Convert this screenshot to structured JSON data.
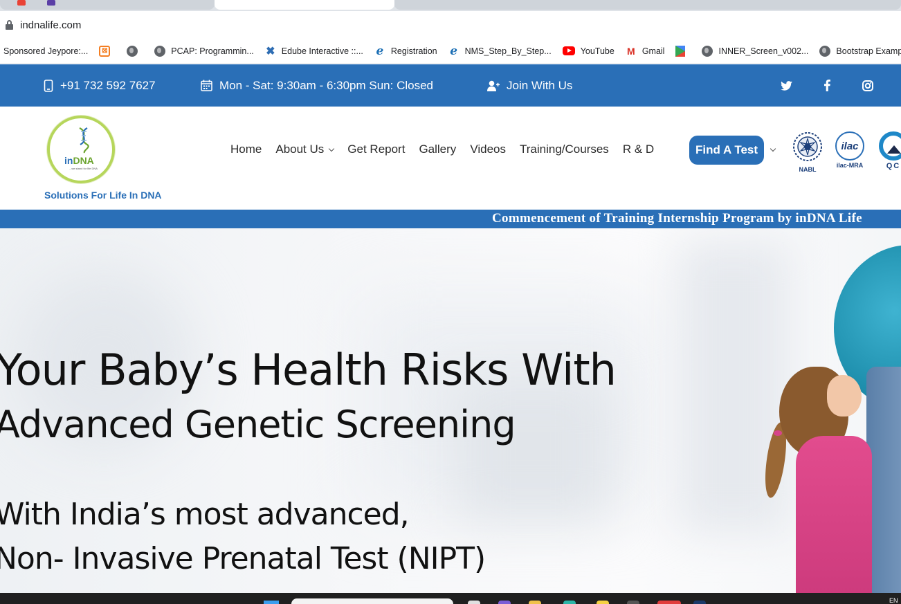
{
  "browser": {
    "url": "indnalife.com",
    "bookmarks": [
      {
        "label": "Sponsored Jeypore:...",
        "icon": "none"
      },
      {
        "label": "",
        "icon": "xampp-icon"
      },
      {
        "label": "",
        "icon": "globe-icon"
      },
      {
        "label": "PCAP: Programmin...",
        "icon": "globe-icon"
      },
      {
        "label": "Edube Interactive ::...",
        "icon": "edube-icon"
      },
      {
        "label": "Registration",
        "icon": "ie-icon"
      },
      {
        "label": "NMS_Step_By_Step...",
        "icon": "ie-icon"
      },
      {
        "label": "YouTube",
        "icon": "youtube-icon"
      },
      {
        "label": "Gmail",
        "icon": "gmail-icon"
      },
      {
        "label": "",
        "icon": "play-store-icon"
      },
      {
        "label": "INNER_Screen_v002...",
        "icon": "globe-icon"
      },
      {
        "label": "Bootstrap Exampl",
        "icon": "globe-icon"
      }
    ]
  },
  "topbar": {
    "phone": "+91 732 592 7627",
    "hours": "Mon - Sat: 9:30am - 6:30pm Sun: Closed",
    "join": "Join With Us",
    "social": [
      "twitter-icon",
      "facebook-icon",
      "instagram-icon"
    ]
  },
  "logo": {
    "brand_in": "in",
    "brand_dna": "DNA",
    "small": "...we stand for life DNA",
    "tagline": "Solutions For Life In DNA"
  },
  "nav": {
    "items": [
      "Home",
      "About Us",
      "Get Report",
      "Gallery",
      "Videos",
      "Training/Courses",
      "R & D"
    ],
    "cta": "Find A Test"
  },
  "accreditations": [
    {
      "label": "NABL",
      "text": ""
    },
    {
      "label": "ilac-MRA",
      "text": "ilac"
    },
    {
      "label": "",
      "text": "QC"
    }
  ],
  "marquee": "Commencement of Training Internship Program by inDNA Life",
  "hero": {
    "line1": "Your Baby’s Health Risks With",
    "line2": "Advanced Genetic Screening",
    "line3": "With India’s most advanced,",
    "line4": "Non- Invasive Prenatal Test (NIPT)"
  },
  "taskbar": {
    "lang": "EN"
  },
  "colors": {
    "brand_blue": "#2a6fb7",
    "brand_green": "#b6d65b",
    "text_dark": "#111111"
  }
}
